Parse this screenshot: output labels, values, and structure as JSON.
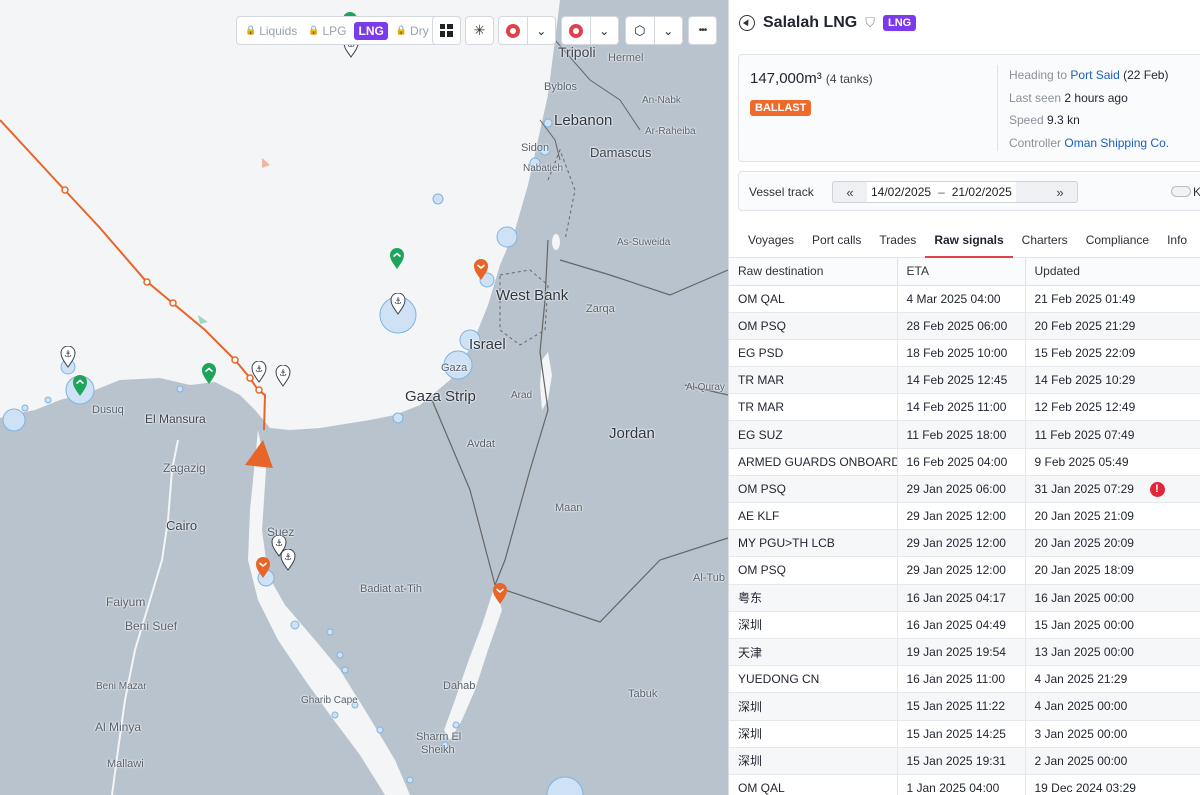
{
  "toolbar": {
    "filters": [
      {
        "label": "Liquids",
        "locked": true,
        "active": false
      },
      {
        "label": "LPG",
        "locked": true,
        "active": false
      },
      {
        "label": "LNG",
        "locked": false,
        "active": true
      },
      {
        "label": "Dry",
        "locked": true,
        "active": false
      }
    ],
    "more_label": "•••"
  },
  "map": {
    "places": [
      {
        "name": "Tripoli",
        "cls": "med"
      },
      {
        "name": "Hermel",
        "cls": ""
      },
      {
        "name": "Byblos",
        "cls": ""
      },
      {
        "name": "An-Nabk",
        "cls": ""
      },
      {
        "name": "Lebanon",
        "cls": "big"
      },
      {
        "name": "Ar-Raheiba",
        "cls": ""
      },
      {
        "name": "Sidon",
        "cls": ""
      },
      {
        "name": "Damascus",
        "cls": "med"
      },
      {
        "name": "Nabatieh",
        "cls": ""
      },
      {
        "name": "As-Suweida",
        "cls": ""
      },
      {
        "name": "West Bank",
        "cls": "big"
      },
      {
        "name": "Zarqa",
        "cls": ""
      },
      {
        "name": "Israel",
        "cls": "big"
      },
      {
        "name": "Gaza",
        "cls": ""
      },
      {
        "name": "Gaza Strip",
        "cls": "big"
      },
      {
        "name": "Arad",
        "cls": ""
      },
      {
        "name": "Al Quray",
        "cls": ""
      },
      {
        "name": "Dusuq",
        "cls": ""
      },
      {
        "name": "El Mansura",
        "cls": "med"
      },
      {
        "name": "Jordan",
        "cls": "big"
      },
      {
        "name": "Avdat",
        "cls": ""
      },
      {
        "name": "Zagazig",
        "cls": ""
      },
      {
        "name": "Cairo",
        "cls": "med"
      },
      {
        "name": "Maan",
        "cls": ""
      },
      {
        "name": "Suez",
        "cls": ""
      },
      {
        "name": "Al-Tub",
        "cls": ""
      },
      {
        "name": "Badiat at-Tih",
        "cls": ""
      },
      {
        "name": "Faiyum",
        "cls": ""
      },
      {
        "name": "Beni Suef",
        "cls": ""
      },
      {
        "name": "Tabuk",
        "cls": ""
      },
      {
        "name": "Beni Mazar",
        "cls": ""
      },
      {
        "name": "Dahab",
        "cls": ""
      },
      {
        "name": "Gharib Cape",
        "cls": ""
      },
      {
        "name": "Al Minya",
        "cls": ""
      },
      {
        "name": "Sharm El",
        "cls": ""
      },
      {
        "name": "Sheikh",
        "cls": ""
      },
      {
        "name": "Mallawi",
        "cls": ""
      }
    ]
  },
  "vessel": {
    "name": "Salalah LNG",
    "type_badge": "LNG",
    "capacity": "147,000m³",
    "tanks": "(4 tanks)",
    "status": "BALLAST",
    "heading_label": "Heading to",
    "heading_port": "Port Said",
    "heading_date": "(22 Feb)",
    "last_seen_label": "Last seen",
    "last_seen": "2 hours ago",
    "speed_label": "Speed",
    "speed": "9.3 kn",
    "controller_label": "Controller",
    "controller": "Oman Shipping Co."
  },
  "track": {
    "label": "Vessel track",
    "start": "14/02/2025",
    "end": "21/02/2025",
    "toggle_label": "K"
  },
  "tabs": [
    "Voyages",
    "Port calls",
    "Trades",
    "Raw signals",
    "Charters",
    "Compliance",
    "Info"
  ],
  "table": {
    "headers": [
      "Raw destination",
      "ETA",
      "Updated"
    ],
    "rows": [
      [
        "OM QAL",
        "4 Mar 2025 04:00",
        "21 Feb 2025 01:49"
      ],
      [
        "OM PSQ",
        "28 Feb 2025 06:00",
        "20 Feb 2025 21:29"
      ],
      [
        "EG PSD",
        "18 Feb 2025 10:00",
        "15 Feb 2025 22:09"
      ],
      [
        "TR MAR",
        "14 Feb 2025 12:45",
        "14 Feb 2025 10:29"
      ],
      [
        "TR MAR",
        "14 Feb 2025 11:00",
        "12 Feb 2025 12:49"
      ],
      [
        "EG SUZ",
        "11 Feb 2025 18:00",
        "11 Feb 2025 07:49"
      ],
      [
        "ARMED GUARDS ONBOARD",
        "16 Feb 2025 04:00",
        "9 Feb 2025 05:49"
      ],
      [
        "OM PSQ",
        "29 Jan 2025 06:00",
        "31 Jan 2025 07:29"
      ],
      [
        "AE KLF",
        "29 Jan 2025 12:00",
        "20 Jan 2025 21:09"
      ],
      [
        "MY PGU>TH LCB",
        "29 Jan 2025 12:00",
        "20 Jan 2025 20:09"
      ],
      [
        "OM PSQ",
        "29 Jan 2025 12:00",
        "20 Jan 2025 18:09"
      ],
      [
        "粤东",
        "16 Jan 2025 04:17",
        "16 Jan 2025 00:00"
      ],
      [
        "深圳",
        "16 Jan 2025 04:49",
        "15 Jan 2025 00:00"
      ],
      [
        "天津",
        "19 Jan 2025 19:54",
        "13 Jan 2025 00:00"
      ],
      [
        "YUEDONG CN",
        "16 Jan 2025 11:00",
        "4 Jan 2025 21:29"
      ],
      [
        "深圳",
        "15 Jan 2025 11:22",
        "4 Jan 2025 00:00"
      ],
      [
        "深圳",
        "15 Jan 2025 14:25",
        "3 Jan 2025 00:00"
      ],
      [
        "深圳",
        "15 Jan 2025 19:31",
        "2 Jan 2025 00:00"
      ],
      [
        "OM QAL",
        "1 Jan 2025 04:00",
        "19 Dec 2024 03:29"
      ]
    ],
    "warning_row": 7,
    "warning_symbol": "!"
  }
}
